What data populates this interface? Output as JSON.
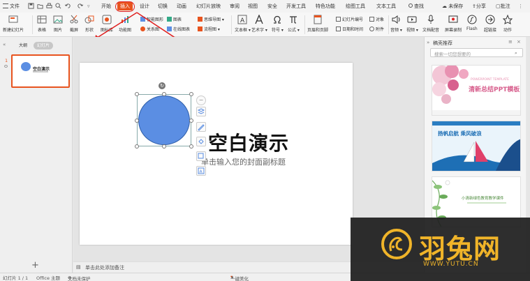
{
  "menu": {
    "file": "文件",
    "tabs": [
      "开始",
      "插入",
      "设计",
      "切换",
      "动画",
      "幻灯片放映",
      "审阅",
      "视图",
      "安全",
      "开发工具",
      "特色功能",
      "绘图工具",
      "文本工具"
    ],
    "search": "查找",
    "account": [
      "未保存",
      "分享",
      "批注"
    ]
  },
  "ribbon": {
    "new_slide": "新建幻灯片",
    "table": "表格",
    "picture": "图片",
    "screenshot": "截屏",
    "shape": "形状",
    "icon_lib": "图标库",
    "func_chart": "功能图",
    "smart_graphic": "智能图形",
    "chart": "图表",
    "relation": "关系图",
    "online_chart": "在线图表",
    "mindmap": "思维导图",
    "flowchart": "流程图",
    "textbox": "文本框",
    "art_text": "艺术字",
    "symbol": "符号",
    "formula": "公式",
    "header_footer": "页眉和页脚",
    "slide_no": "幻灯片编号",
    "object": "对象",
    "datetime": "日期和时间",
    "attachment": "附件",
    "audio": "音频",
    "video": "视频",
    "dub": "文档配音",
    "record": "屏幕录制",
    "flash": "Flash",
    "hyperlink": "超链接",
    "action": "动作"
  },
  "left_panel": {
    "tab_outline": "大纲",
    "tab_slides": "幻灯片",
    "slide_number": "1",
    "thumb_title": "空白演示",
    "add": "+"
  },
  "slide": {
    "title": "空白演示",
    "subtitle": "单击输入您的封面副标题"
  },
  "notes_placeholder": "单击此处添加备注",
  "right_panel": {
    "title": "稿壳推荐",
    "search_placeholder": "搜索一切您想要的",
    "templates": [
      {
        "heading": "POWERPOINT TEMPLATE",
        "title": "清新总结PPT模板"
      },
      {
        "title": "扬帆启航 乘风破浪"
      },
      {
        "title": "小清新绿色教育教学课件"
      }
    ]
  },
  "status": {
    "slide_index": "幻灯片 1 / 1",
    "theme": "Office 主题",
    "protect": "文档未保护",
    "beautify": "一键美化"
  },
  "watermark": {
    "name": "羽兔网",
    "url": "WWW.YUTU.CN"
  },
  "colors": {
    "accent": "#e8541f",
    "shape_fill": "#5b8ee3",
    "annotation_red": "#e02020",
    "watermark_gold": "#f0b429"
  }
}
